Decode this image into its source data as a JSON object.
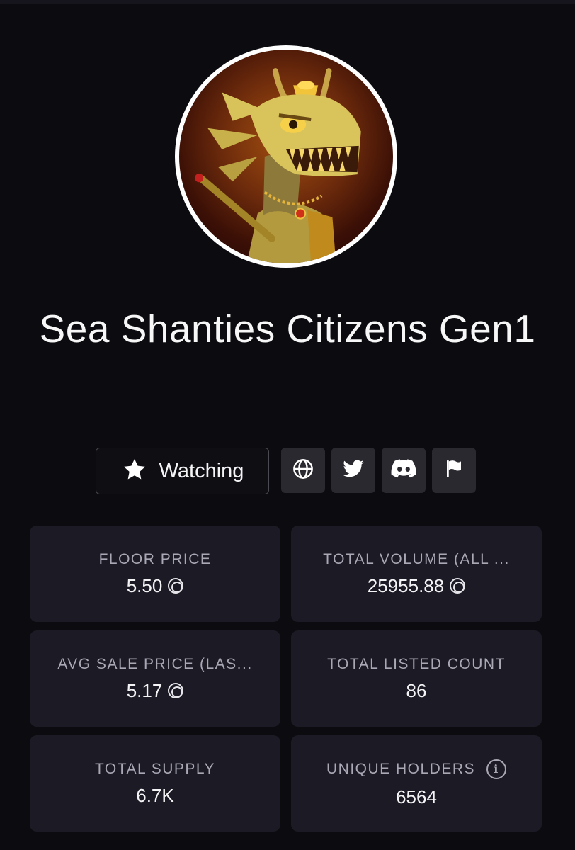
{
  "collection": {
    "name": "Sea Shanties Citizens Gen1",
    "avatar_icon": "dragon-avatar"
  },
  "actions": {
    "watch_label": "Watching",
    "watch_icon": "star-icon",
    "links": [
      {
        "name": "website",
        "icon": "globe-icon"
      },
      {
        "name": "twitter",
        "icon": "twitter-icon"
      },
      {
        "name": "discord",
        "icon": "discord-icon"
      },
      {
        "name": "report",
        "icon": "flag-icon"
      }
    ]
  },
  "stats": {
    "floor_price": {
      "label": "FLOOR PRICE",
      "value": "5.50",
      "currency_icon": "sol-icon"
    },
    "total_volume": {
      "label": "TOTAL VOLUME (ALL ...",
      "value": "25955.88",
      "currency_icon": "sol-icon"
    },
    "avg_sale_price": {
      "label": "AVG SALE PRICE (LAS...",
      "value": "5.17",
      "currency_icon": "sol-icon"
    },
    "total_listed": {
      "label": "TOTAL LISTED COUNT",
      "value": "86"
    },
    "total_supply": {
      "label": "TOTAL SUPPLY",
      "value": "6.7K"
    },
    "unique_holders": {
      "label": "UNIQUE HOLDERS",
      "value": "6564",
      "info_icon": "info-icon"
    }
  },
  "colors": {
    "background": "#0c0b10",
    "card": "#1b1a25",
    "icon_button": "#2a2930",
    "label": "#a9a8b4",
    "text": "#f4f4f6"
  }
}
